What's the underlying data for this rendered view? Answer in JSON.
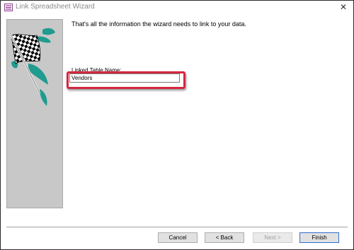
{
  "window": {
    "title": "Link Spreadsheet Wizard",
    "close_symbol": "✕"
  },
  "main": {
    "info_text": "That's all the information the wizard needs to link to your data.",
    "linked_table_label": "Linked Table Name:",
    "linked_table_value": "Vendors"
  },
  "buttons": {
    "cancel": "Cancel",
    "back": "< Back",
    "next": "Next >",
    "finish": "Finish"
  },
  "colors": {
    "highlight": "#d6263f",
    "flag_accent": "#1f9b8f",
    "panel_background": "#c8c8c8"
  },
  "icons": {
    "window": "wizard-window-icon",
    "art": "checkered-flag-icon"
  }
}
